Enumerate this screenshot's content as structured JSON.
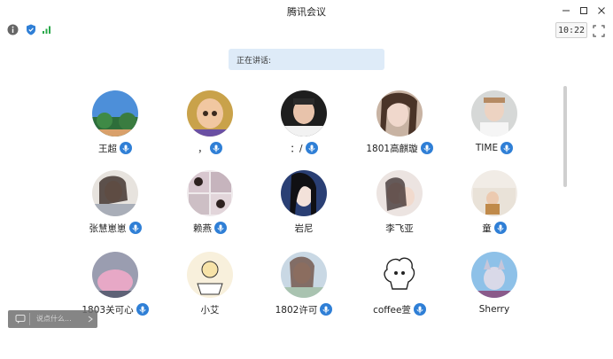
{
  "window": {
    "title": "腾讯会议"
  },
  "toolbar": {
    "time": "10:22"
  },
  "speaking": {
    "label": "正在讲话:"
  },
  "chat": {
    "placeholder": "说点什么..."
  },
  "participants": [
    {
      "name": "王超",
      "mic": true
    },
    {
      "name": "，",
      "mic": true
    },
    {
      "name": "：/",
      "mic": true
    },
    {
      "name": "1801高麒璇",
      "mic": true
    },
    {
      "name": "TIME",
      "mic": true
    },
    {
      "name": "张慧崽崽",
      "mic": true
    },
    {
      "name": "赖燕",
      "mic": true
    },
    {
      "name": "岩尼",
      "mic": false
    },
    {
      "name": "李飞亚",
      "mic": false
    },
    {
      "name": "童",
      "mic": true
    },
    {
      "name": "1803关可心",
      "mic": true
    },
    {
      "name": "小艾",
      "mic": false
    },
    {
      "name": "1802许可",
      "mic": true
    },
    {
      "name": "coffee萱",
      "mic": true
    },
    {
      "name": "Sherry",
      "mic": false
    }
  ],
  "colors": {
    "mic": "#2f7fd6",
    "speaking_bg": "#deebf8",
    "signal": "#2aa84a",
    "shield": "#2f7fd6"
  }
}
